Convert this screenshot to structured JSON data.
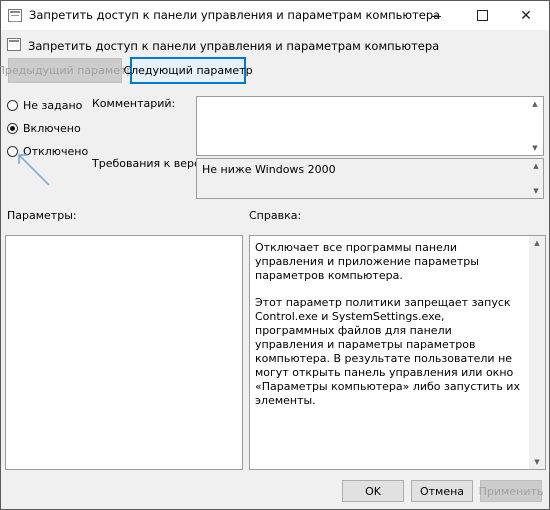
{
  "window": {
    "title": "Запретить доступ к панели управления и параметрам компьютера",
    "icon": "policy-icon",
    "controls": {
      "minimize": "–",
      "maximize": "□",
      "close": "✕"
    }
  },
  "header": {
    "title": "Запретить доступ к панели управления и параметрам компьютера",
    "prev_label": "Предыдущий параметр",
    "next_label": "Следующий параметр"
  },
  "state": {
    "options": [
      {
        "label": "Не задано",
        "checked": false
      },
      {
        "label": "Включено",
        "checked": true
      },
      {
        "label": "Отключено",
        "checked": false
      }
    ]
  },
  "comment": {
    "label": "Комментарий:",
    "value": ""
  },
  "version": {
    "label": "Требования к версии:",
    "value": "Не ниже Windows 2000"
  },
  "sections": {
    "params_label": "Параметры:",
    "help_label": "Справка:"
  },
  "help": {
    "paragraphs": [
      "Отключает все программы панели управления и приложение параметры параметров компьютера.",
      "Этот параметр политики запрещает запуск Control.exe и SystemSettings.exe, программных файлов для панели управления и параметры параметров компьютера. В результате пользователи не могут открыть панель управления или окно «Параметры компьютера» либо запустить их элементы."
    ]
  },
  "footer": {
    "ok_label": "OK",
    "cancel_label": "Отмена",
    "apply_label": "Применить"
  },
  "colors": {
    "accent": "#0078d7",
    "annotation_arrow": "#6fa8d6"
  }
}
